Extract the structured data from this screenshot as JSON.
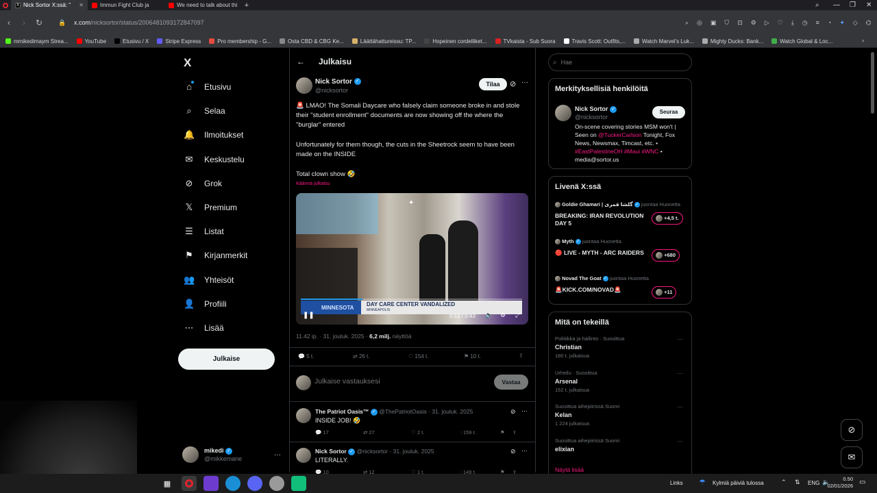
{
  "browser": {
    "tabs": [
      {
        "title": "Nick Sortor X:ssä: \"",
        "active": true
      },
      {
        "title": "Immun Fight Club ja",
        "active": false
      },
      {
        "title": "We need to talk about thi",
        "active": false
      }
    ],
    "new_tab": "+",
    "url_host": "x.com",
    "url_path": "/nicksortor/status/2006481093172847097",
    "bookmarks": [
      {
        "label": "mmikedimaym Strea...",
        "color": "#53fc18"
      },
      {
        "label": "YouTube",
        "color": "#ff0000"
      },
      {
        "label": "Etusivu / X",
        "color": "#000000"
      },
      {
        "label": "Stripe Express",
        "color": "#635bff"
      },
      {
        "label": "Pro membership - G...",
        "color": "#e34c3f"
      },
      {
        "label": "Osta CBD & CBG Ke...",
        "color": "#888888"
      },
      {
        "label": "Läättähattureissu: TP...",
        "color": "#d7b16a"
      },
      {
        "label": "Hopeinen cordelliket...",
        "color": "#444444"
      },
      {
        "label": "TVkaista - Sub Suora",
        "color": "#d92121"
      },
      {
        "label": "Travis Scott: Outfits,...",
        "color": "#ffffff"
      },
      {
        "label": "Watch Marvel's Luk...",
        "color": "#aaaaaa"
      },
      {
        "label": "Mighty Ducks: Bank...",
        "color": "#aaaaaa"
      },
      {
        "label": "Watch Global & Loc...",
        "color": "#3fae49"
      }
    ]
  },
  "sidebar": {
    "logo": "X",
    "items": [
      {
        "label": "Etusivu",
        "icon": "home-icon",
        "glyph": "⌂"
      },
      {
        "label": "Selaa",
        "icon": "search-icon",
        "glyph": "⌕"
      },
      {
        "label": "Ilmoitukset",
        "icon": "bell-icon",
        "glyph": "🔔"
      },
      {
        "label": "Keskustelu",
        "icon": "mail-icon",
        "glyph": "✉"
      },
      {
        "label": "Grok",
        "icon": "grok-icon",
        "glyph": "⊘"
      },
      {
        "label": "Premium",
        "icon": "x-premium-icon",
        "glyph": "𝕏"
      },
      {
        "label": "Listat",
        "icon": "list-icon",
        "glyph": "☰"
      },
      {
        "label": "Kirjanmerkit",
        "icon": "bookmark-icon",
        "glyph": "⚑"
      },
      {
        "label": "Yhteisöt",
        "icon": "communities-icon",
        "glyph": "👥"
      },
      {
        "label": "Profiili",
        "icon": "profile-icon",
        "glyph": "👤"
      },
      {
        "label": "Lisää",
        "icon": "more-icon",
        "glyph": "⋯"
      }
    ],
    "post_button": "Julkaise",
    "account": {
      "name": "mikedi",
      "handle": "@mikkemane",
      "more": "···"
    }
  },
  "main": {
    "header_title": "Julkaisu",
    "post": {
      "author": "Nick Sortor",
      "handle": "@nicksortor",
      "subscribe": "Tilaa",
      "text1": "🚨 LMAO! The Somali Daycare who falsely claim someone broke in and stole their \"student enrollment\" documents are now showing off the where the \"burglar\" entered",
      "text2": "Unfortunately for them though, the cuts in the Sheetrock seem to have been made on the INSIDE",
      "text3": "Total clown show 🤣",
      "translate": "Käännä julkaisu",
      "video": {
        "time": "0:12 / 0:43",
        "lower_third_place": "MINNESOTA",
        "lower_third_text": "DAY CARE CENTER VANDALIZED",
        "lower_third_city": "MINNEAPOLIS",
        "progress": 0.28
      },
      "meta_time": "11.42 ip. · 31. jouluk. 2025 ·",
      "views": "6,2 milj.",
      "views_label": "näyttöä",
      "stats": {
        "replies": "5 t.",
        "reposts": "26 t.",
        "likes": "154 t.",
        "bookmarks": "10 t."
      }
    },
    "reply_placeholder": "Julkaise vastauksesi",
    "reply_button": "Vastaa",
    "replies": [
      {
        "author": "The Patriot Oasis™",
        "handle": "@ThePatriotOasis",
        "date": "· 31. jouluk. 2025",
        "text": "INSIDE JOB! 🤣",
        "stats": {
          "replies": "17",
          "reposts": "27",
          "likes": "2 t.",
          "views": "159 t."
        }
      },
      {
        "author": "Nick Sortor",
        "handle": "@nicksortor",
        "date": "· 31. jouluk. 2025",
        "text": "LITERALLY.",
        "stats": {
          "replies": "10",
          "reposts": "12",
          "likes": "1 t.",
          "views": "149 t."
        }
      }
    ]
  },
  "right": {
    "search_placeholder": "Hae",
    "relevant": {
      "title": "Merkityksellisiä henkilöitä",
      "name": "Nick Sortor",
      "handle": "@nicksortor",
      "follow": "Seuraa",
      "bio_pre": "On-scene covering stories MSM won't | Seen on",
      "bio_mention": "@TuckerCarlson",
      "bio_mid": "Tonight, Fox News, Newsmax, Timcast, etc. •",
      "bio_tags": "#EastPalestineOH #Maui #WNC",
      "bio_end": "• media@sortor.us"
    },
    "live": {
      "title": "Livenä X:ssä",
      "items": [
        {
          "host": "Goldie Ghamari | گلشا قمری",
          "status": "juontaa Huonetta",
          "title": "BREAKING: IRAN REVOLUTION DAY 5",
          "count": "+4,5 t."
        },
        {
          "host": "Myth",
          "status": "juontaa Huonetta",
          "title": "🔴 LIVE - MYTH - ARC RAIDERS",
          "count": "+680"
        },
        {
          "host": "Novad The Goat",
          "status": "juontaa Huonetta",
          "title": "🚨KICK.COM/NOVAD🚨",
          "count": "+11"
        }
      ]
    },
    "trends": {
      "title": "Mitä on tekeillä",
      "items": [
        {
          "context": "Politiikka ja hallinto · Suosittua",
          "name": "Christian",
          "count": "180 t. julkaisua"
        },
        {
          "context": "Urheilu · Suosittua",
          "name": "Arsenal",
          "count": "152 t. julkaisua"
        },
        {
          "context": "Suosittua aihepiirissä Suomi",
          "name": "Kelan",
          "count": "1 224 julkaisua"
        },
        {
          "context": "Suosittua aihepiirissä Suomi",
          "name": "elixian",
          "count": ""
        }
      ],
      "show_more": "Näytä lisää"
    }
  },
  "taskbar": {
    "links": "Links",
    "weather": "Kylmiä päiviä tulossa",
    "lang": "ENG",
    "time": "0.50",
    "date": "02/01/2026"
  }
}
